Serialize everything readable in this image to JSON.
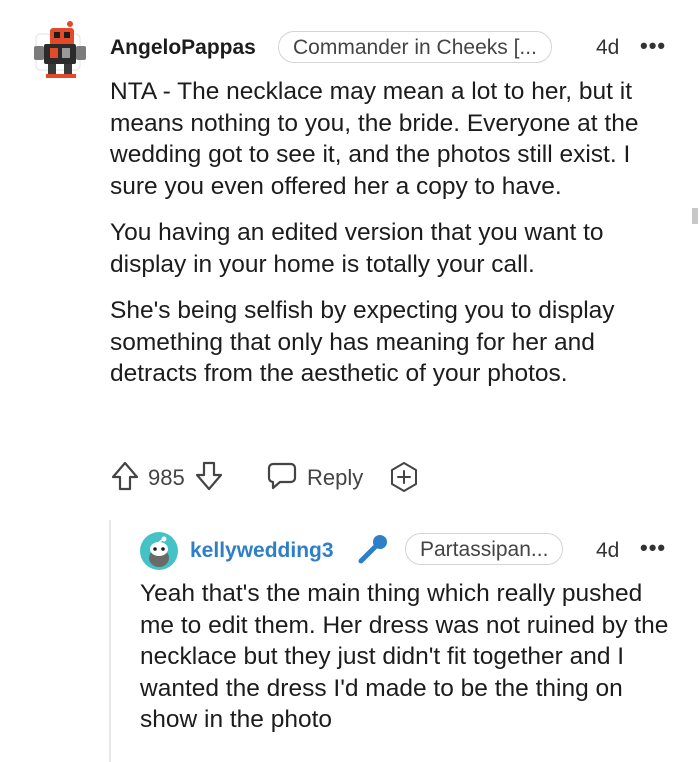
{
  "comment": {
    "author": "AngeloPappas",
    "flair": "Commander in Cheeks [...",
    "time": "4d",
    "more": "•••",
    "paragraphs": [
      "NTA - The necklace may mean a lot to her, but it means nothing to you, the bride. Everyone at the wedding got to see it, and the photos still exist. I sure you even offered her a copy to have.",
      "You having an edited version that you want to display in your home is totally your call.",
      "She's being selfish by expecting you to display something that only has meaning for her and detracts from the aesthetic of your photos."
    ],
    "votes": "985",
    "reply_label": "Reply"
  },
  "reply": {
    "author": "kellywedding3",
    "flair": "Partassipan...",
    "time": "4d",
    "more": "•••",
    "text": "Yeah that's the main thing which really pushed me to edit them. Her dress was not ruined by the necklace but they just didn't fit together and I wanted the dress I'd made to be the thing on show in the photo"
  },
  "colors": {
    "mic_icon": "#2d7fc7",
    "reply_username": "#2d7fc7",
    "avatar_teal": "#44c2c6"
  }
}
